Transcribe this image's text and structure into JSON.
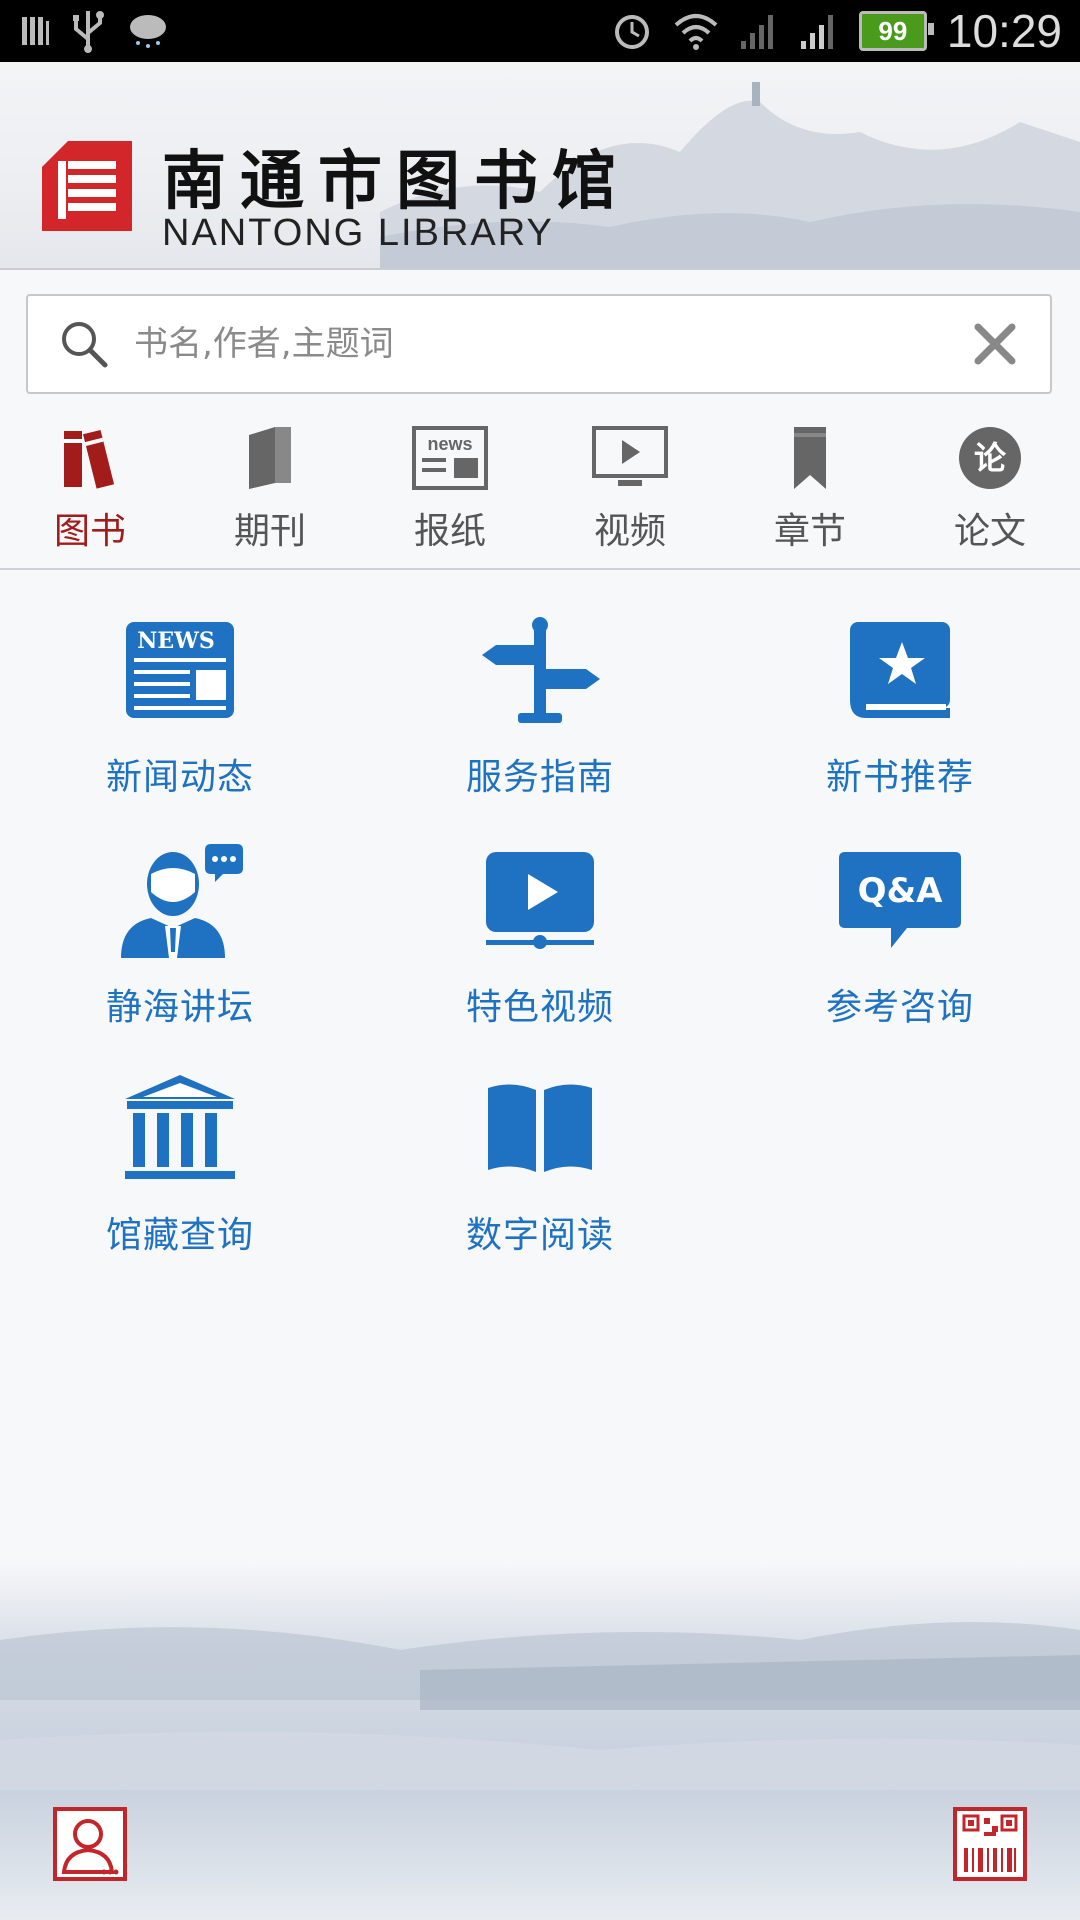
{
  "status_bar": {
    "time": "10:29",
    "battery": "99"
  },
  "header": {
    "title_cn": "南通市图书馆",
    "title_en": "NANTONG LIBRARY"
  },
  "search": {
    "placeholder": "书名,作者,主题词"
  },
  "tabs": [
    {
      "label": "图书",
      "icon": "books-icon",
      "active": true
    },
    {
      "label": "期刊",
      "icon": "journal-icon"
    },
    {
      "label": "报纸",
      "icon": "newspaper-icon"
    },
    {
      "label": "视频",
      "icon": "video-icon"
    },
    {
      "label": "章节",
      "icon": "bookmark-icon"
    },
    {
      "label": "论文",
      "icon": "paper-icon",
      "icon_text": "论"
    }
  ],
  "grid": [
    {
      "label": "新闻动态",
      "icon": "news-icon",
      "icon_text": "NEWS"
    },
    {
      "label": "服务指南",
      "icon": "signpost-icon"
    },
    {
      "label": "新书推荐",
      "icon": "star-book-icon"
    },
    {
      "label": "静海讲坛",
      "icon": "lecture-icon"
    },
    {
      "label": "特色视频",
      "icon": "play-video-icon"
    },
    {
      "label": "参考咨询",
      "icon": "qa-icon",
      "icon_text": "Q&A"
    },
    {
      "label": "馆藏查询",
      "icon": "museum-icon"
    },
    {
      "label": "数字阅读",
      "icon": "open-book-icon"
    }
  ],
  "colors": {
    "accent": "#1f72c2",
    "active_tab": "#a31c1c",
    "logo_red": "#d2262a"
  }
}
